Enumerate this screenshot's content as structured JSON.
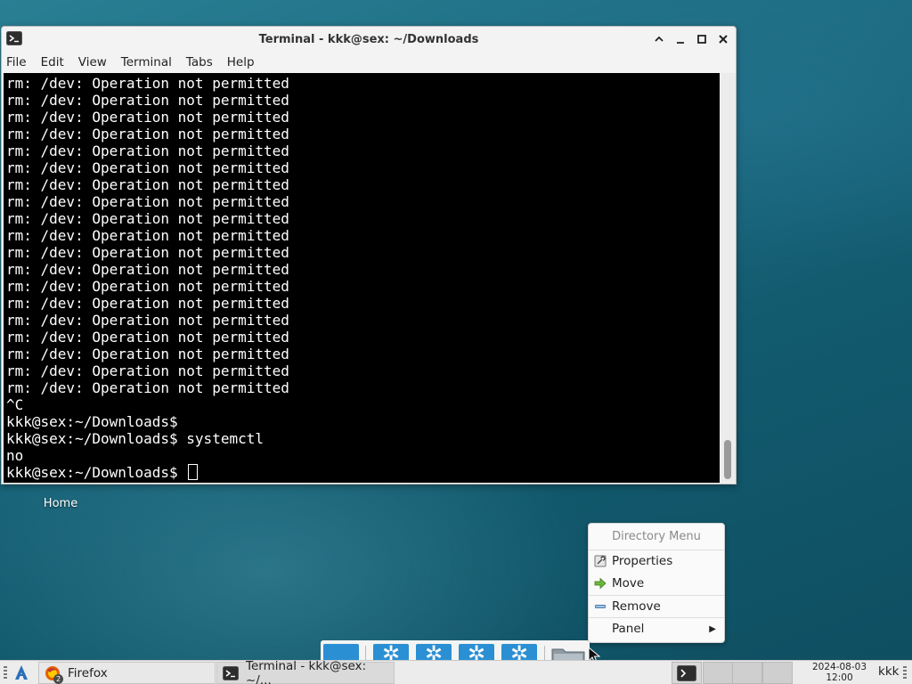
{
  "window": {
    "title": "Terminal - kkk@sex: ~/Downloads",
    "controls": {
      "shade": "^",
      "minimize": "_",
      "maximize": "□",
      "close": "✕"
    }
  },
  "menubar": [
    "File",
    "Edit",
    "View",
    "Terminal",
    "Tabs",
    "Help"
  ],
  "terminal": {
    "lines": [
      "rm: /dev: Operation not permitted",
      "rm: /dev: Operation not permitted",
      "rm: /dev: Operation not permitted",
      "rm: /dev: Operation not permitted",
      "rm: /dev: Operation not permitted",
      "rm: /dev: Operation not permitted",
      "rm: /dev: Operation not permitted",
      "rm: /dev: Operation not permitted",
      "rm: /dev: Operation not permitted",
      "rm: /dev: Operation not permitted",
      "rm: /dev: Operation not permitted",
      "rm: /dev: Operation not permitted",
      "rm: /dev: Operation not permitted",
      "rm: /dev: Operation not permitted",
      "rm: /dev: Operation not permitted",
      "rm: /dev: Operation not permitted",
      "rm: /dev: Operation not permitted",
      "rm: /dev: Operation not permitted",
      "rm: /dev: Operation not permitted",
      "^C",
      "kkk@sex:~/Downloads$",
      "kkk@sex:~/Downloads$ systemctl",
      "no"
    ],
    "prompt": "kkk@sex:~/Downloads$ "
  },
  "desktop": {
    "home_label": "Home"
  },
  "context_menu": {
    "header": "Directory Menu",
    "items": [
      {
        "label": "Properties",
        "icon": "properties-icon"
      },
      {
        "label": "Move",
        "icon": "move-arrow-icon"
      },
      {
        "label": "Remove",
        "icon": "remove-icon"
      },
      {
        "label": "Panel",
        "icon": "submenu-arrow-icon",
        "submenu_arrow": "▶"
      }
    ]
  },
  "dock": {
    "gear_glyph": "✲"
  },
  "taskbar": {
    "tasks": [
      {
        "label": "Firefox",
        "icon": "firefox-icon",
        "badge": "2"
      },
      {
        "label": "Terminal - kkk@sex: ~/...",
        "icon": "terminal-icon"
      }
    ],
    "clock_date": "2024-08-03",
    "clock_time": "12:00",
    "user": "kkk"
  },
  "colors": {
    "accent": "#2b8fd3",
    "terminal_bg": "#000000",
    "terminal_fg": "#ffffff"
  }
}
